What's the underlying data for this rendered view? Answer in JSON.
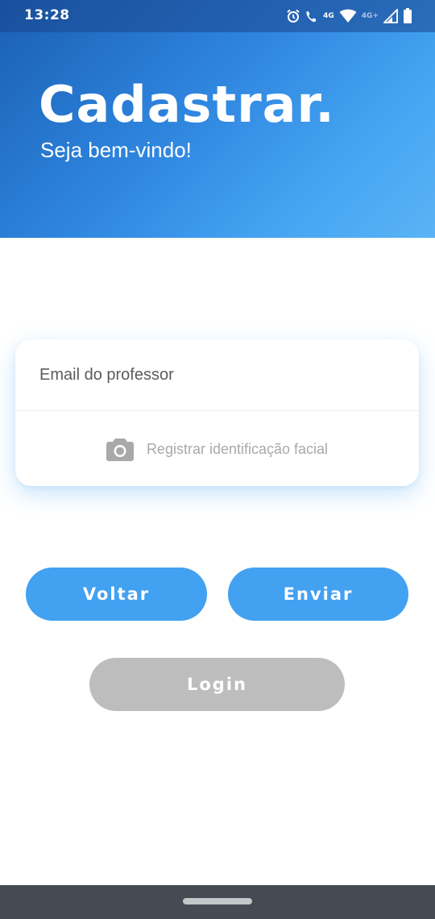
{
  "status_bar": {
    "time": "13:28",
    "net_label_1": "4G",
    "net_label_2": "4G+",
    "icons": [
      "alarm-icon",
      "volte-call-icon",
      "wifi-icon",
      "signal-icon",
      "battery-icon"
    ]
  },
  "header": {
    "title": "Cadastrar.",
    "subtitle": "Seja bem-vindo!"
  },
  "form": {
    "email_placeholder": "Email do professor",
    "face_label": "Registrar identificação facial",
    "face_icon": "camera-icon"
  },
  "buttons": {
    "back": "Voltar",
    "send": "Enviar",
    "login": "Login"
  },
  "colors": {
    "primary": "#42a1f0",
    "header_dark": "#1a5fb4",
    "header_light": "#5ab3f5",
    "disabled": "#bdbdbd",
    "nav_bar": "#454b52"
  }
}
